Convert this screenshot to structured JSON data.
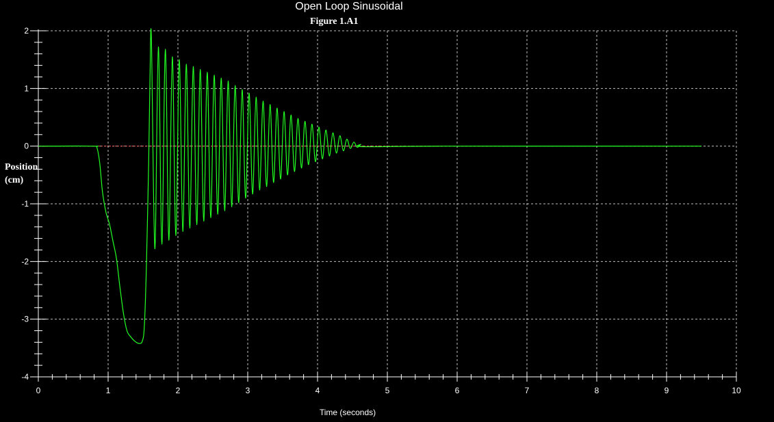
{
  "chart_data": {
    "type": "line",
    "title": "Open Loop Sinusoidal",
    "subtitle": "Figure 1.A1",
    "xlabel": "Time (seconds)",
    "ylabel_line1": "Position",
    "ylabel_line2": "(cm)",
    "xlim": [
      0,
      10
    ],
    "ylim": [
      -4,
      2
    ],
    "x_ticks": [
      0,
      1,
      2,
      3,
      4,
      5,
      6,
      7,
      8,
      9,
      10
    ],
    "y_ticks": [
      -4,
      -3,
      -2,
      -1,
      0,
      1,
      2
    ],
    "grid": true,
    "colors": {
      "background": "#000000",
      "series": "#22ff22",
      "grid": "#ffffff",
      "reference": "#ff4444"
    },
    "series": [
      {
        "points": [
          [
            0,
            0
          ],
          [
            0.78,
            0
          ],
          [
            0.84,
            -0.03
          ],
          [
            0.88,
            -0.3
          ],
          [
            0.92,
            -0.8
          ],
          [
            0.97,
            -1.15
          ],
          [
            1.02,
            -1.35
          ],
          [
            1.07,
            -1.65
          ],
          [
            1.12,
            -1.95
          ],
          [
            1.17,
            -2.45
          ],
          [
            1.22,
            -2.9
          ],
          [
            1.27,
            -3.2
          ],
          [
            1.32,
            -3.3
          ],
          [
            1.38,
            -3.38
          ],
          [
            1.44,
            -3.42
          ],
          [
            1.49,
            -3.38
          ],
          [
            1.52,
            -3.1
          ],
          [
            1.55,
            -2.0
          ],
          [
            1.58,
            -0.3
          ],
          [
            1.6,
            1.2
          ],
          [
            1.62,
            1.88
          ]
        ],
        "oscillation": {
          "start": 1.62,
          "end": 5.72,
          "period": 0.1,
          "peak_amplitude": 1.88,
          "peaks": [
            1.88,
            1.72,
            1.68,
            1.55,
            1.5,
            1.42,
            1.38,
            1.33,
            1.28,
            1.23,
            1.18,
            1.13,
            1.05,
            0.98,
            0.92,
            0.85,
            0.78,
            0.72,
            0.66,
            0.6,
            0.54,
            0.48,
            0.43,
            0.38,
            0.33,
            0.28,
            0.23,
            0.18,
            0.12,
            0.07,
            0.03
          ],
          "troughs": [
            -1.78,
            -1.7,
            -1.63,
            -1.55,
            -1.48,
            -1.42,
            -1.36,
            -1.3,
            -1.24,
            -1.18,
            -1.12,
            -1.05,
            -0.98,
            -0.9,
            -0.83,
            -0.76,
            -0.7,
            -0.63,
            -0.57,
            -0.5,
            -0.44,
            -0.38,
            -0.32,
            -0.27,
            -0.22,
            -0.17,
            -0.12,
            -0.08,
            -0.04,
            -0.02,
            -0.01
          ]
        },
        "tail": [
          [
            5.8,
            0
          ],
          [
            9.5,
            0
          ]
        ]
      }
    ]
  }
}
